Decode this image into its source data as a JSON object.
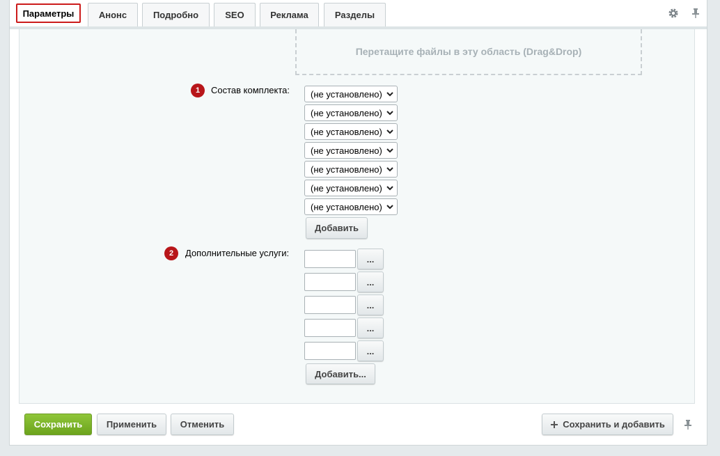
{
  "tabs": [
    {
      "label": "Параметры",
      "active": true
    },
    {
      "label": "Анонс"
    },
    {
      "label": "Подробно"
    },
    {
      "label": "SEO"
    },
    {
      "label": "Реклама"
    },
    {
      "label": "Разделы"
    }
  ],
  "toolbar": {
    "settings_icon": "gear-icon",
    "pin_icon": "pin-icon"
  },
  "dropzone": {
    "text": "Перетащите файлы в эту область (Drag&Drop)"
  },
  "kit": {
    "badge": "1",
    "label": "Состав комплекта:",
    "selects": [
      "(не установлено)",
      "(не установлено)",
      "(не установлено)",
      "(не установлено)",
      "(не установлено)",
      "(не установлено)",
      "(не установлено)"
    ],
    "add_button": "Добавить"
  },
  "services": {
    "badge": "2",
    "label": "Дополнительные услуги:",
    "inputs": [
      "",
      "",
      "",
      "",
      ""
    ],
    "browse_label": "...",
    "add_button": "Добавить..."
  },
  "footer": {
    "save": "Сохранить",
    "apply": "Применить",
    "cancel": "Отменить",
    "save_add": "Сохранить и добавить",
    "save_add_icon": "plus-icon",
    "pin_icon": "pin-icon"
  },
  "colors": {
    "accent_red": "#b8161a",
    "save_green": "#7ab82a"
  }
}
